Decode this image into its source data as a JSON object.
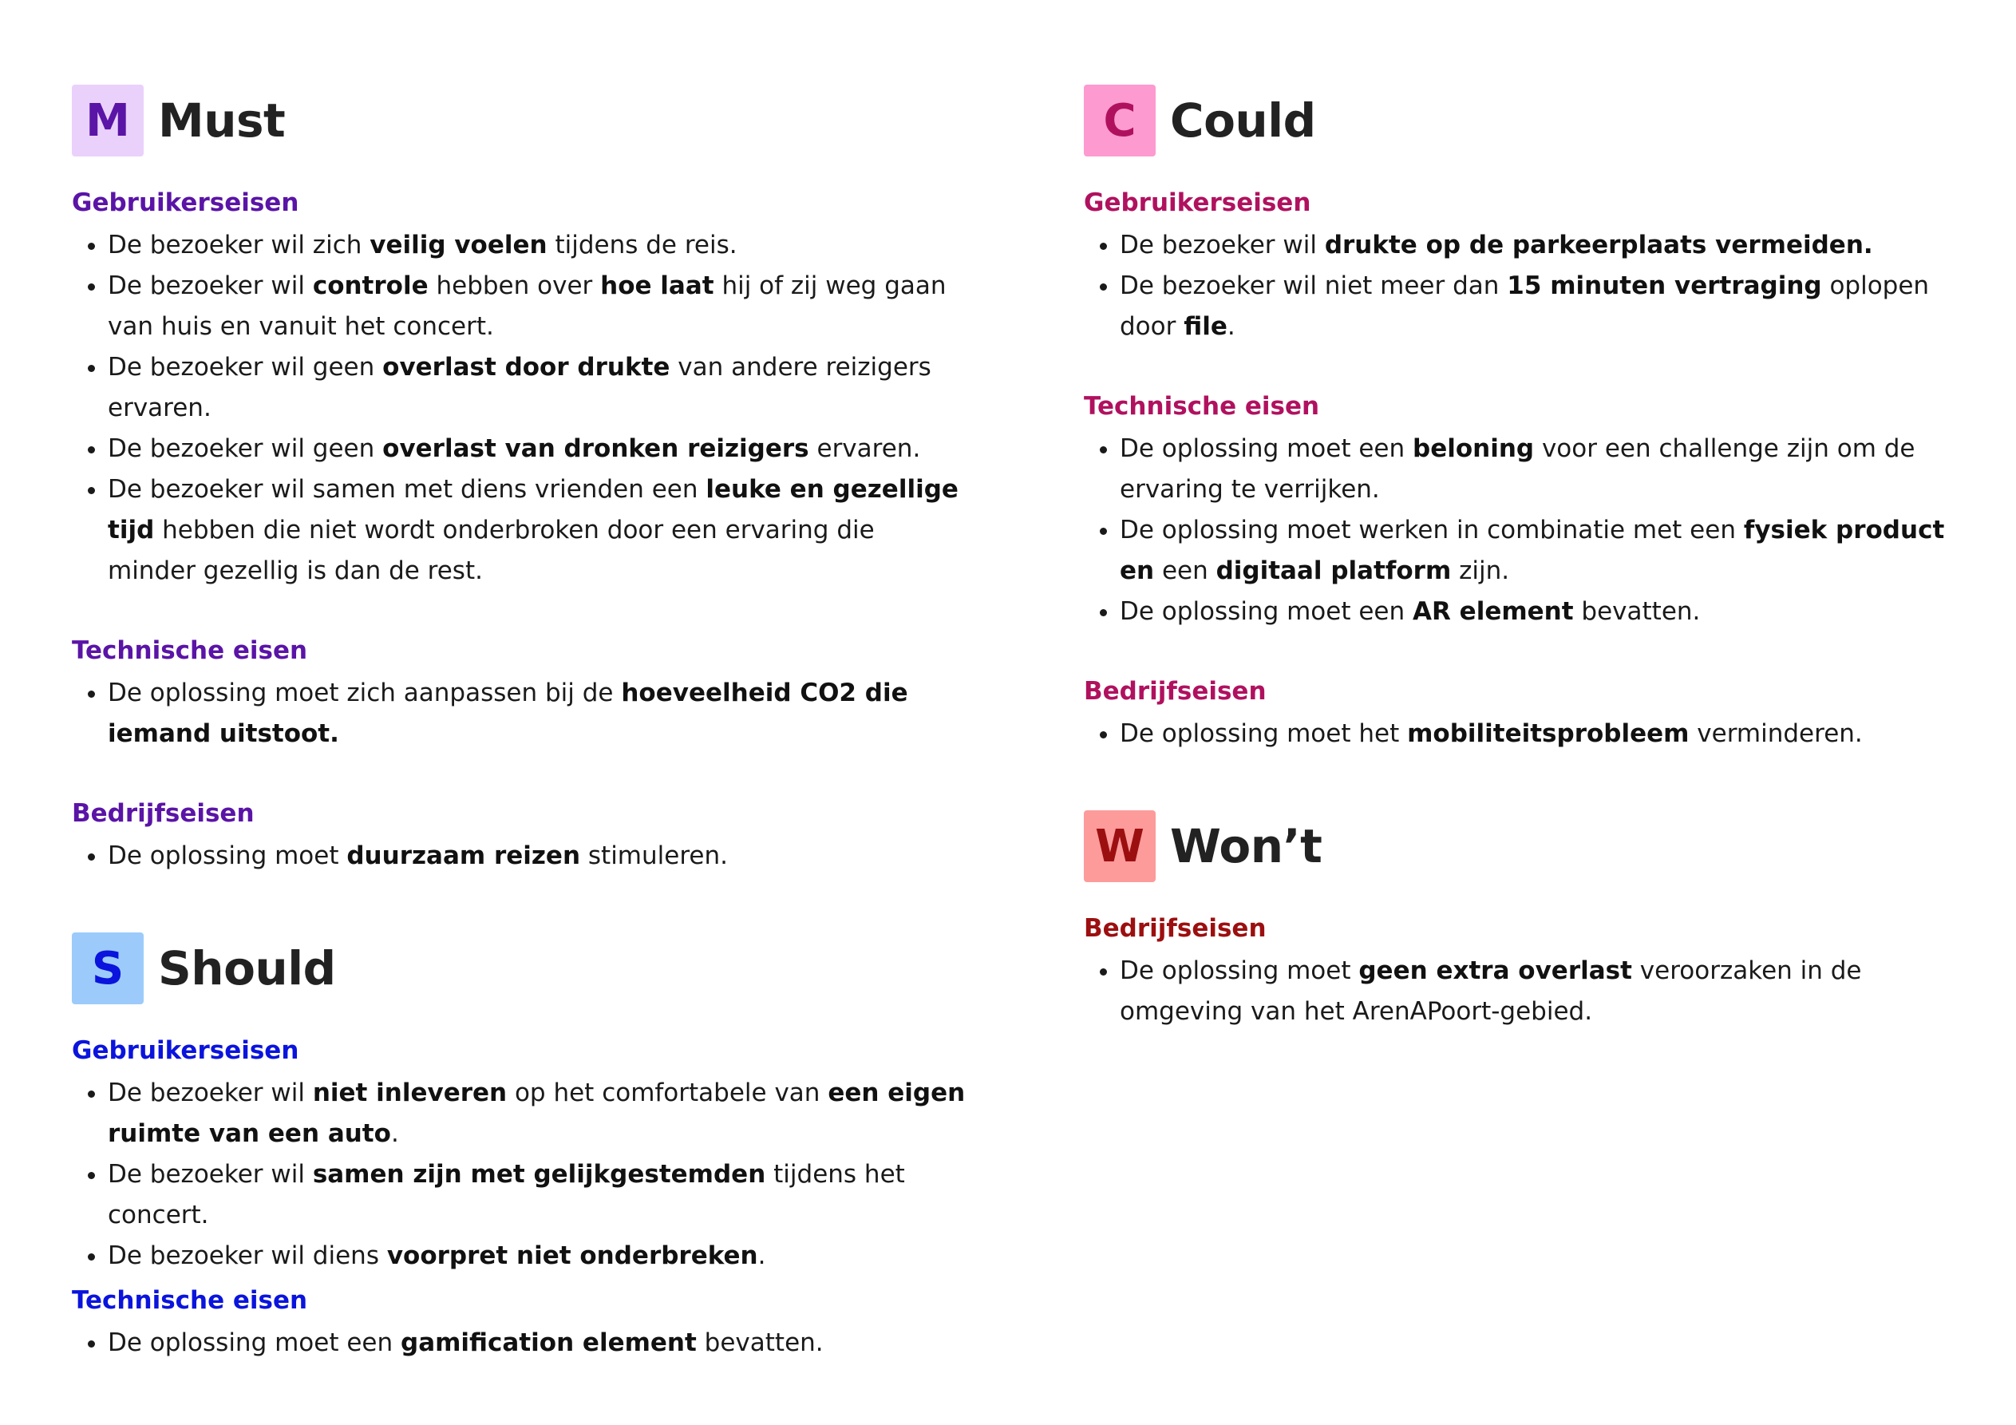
{
  "categories": [
    {
      "key": "must",
      "letter": "M",
      "title": "Must",
      "colors": {
        "bg": "#ead1fb",
        "letter": "#5a14a6",
        "heading": "#5a14a6"
      },
      "groups": [
        {
          "title": "Gebruikerseisen",
          "items": [
            [
              {
                "t": "De bezoeker wil zich "
              },
              {
                "t": "veilig voelen",
                "b": true
              },
              {
                "t": " tijdens de reis."
              }
            ],
            [
              {
                "t": "De bezoeker wil "
              },
              {
                "t": "controle",
                "b": true
              },
              {
                "t": " hebben over "
              },
              {
                "t": "hoe laat",
                "b": true
              },
              {
                "t": " hij of zij weg gaan van huis en vanuit het concert."
              }
            ],
            [
              {
                "t": "De bezoeker wil geen "
              },
              {
                "t": "overlast door drukte",
                "b": true
              },
              {
                "t": " van andere reizigers ervaren."
              }
            ],
            [
              {
                "t": "De bezoeker wil geen "
              },
              {
                "t": "overlast van dronken reizigers",
                "b": true
              },
              {
                "t": " ervaren."
              }
            ],
            [
              {
                "t": "De bezoeker wil samen met diens vrienden een "
              },
              {
                "t": "leuke en gezellige tijd",
                "b": true
              },
              {
                "t": " hebben die niet wordt onderbroken door een ervaring die minder gezellig is dan de rest."
              }
            ]
          ]
        },
        {
          "title": "Technische eisen",
          "items": [
            [
              {
                "t": "De oplossing moet zich aanpassen bij de "
              },
              {
                "t": "hoeveelheid CO2 die iemand uitstoot.",
                "b": true
              }
            ]
          ]
        },
        {
          "title": "Bedrijfseisen",
          "items": [
            [
              {
                "t": "De oplossing moet "
              },
              {
                "t": "duurzaam reizen",
                "b": true
              },
              {
                "t": " stimuleren."
              }
            ]
          ]
        }
      ]
    },
    {
      "key": "should",
      "letter": "S",
      "title": "Should",
      "colors": {
        "bg": "#9ccbfb",
        "letter": "#0a14dc",
        "heading": "#0a14dc"
      },
      "groups": [
        {
          "title": "Gebruikerseisen",
          "items": [
            [
              {
                "t": "De bezoeker wil "
              },
              {
                "t": "niet inleveren",
                "b": true
              },
              {
                "t": " op het comfortabele van "
              },
              {
                "t": "een eigen ruimte van een auto",
                "b": true
              },
              {
                "t": "."
              }
            ],
            [
              {
                "t": "De bezoeker wil "
              },
              {
                "t": "samen zijn met gelijkgestemden",
                "b": true
              },
              {
                "t": " tijdens het concert."
              }
            ],
            [
              {
                "t": "De bezoeker wil diens "
              },
              {
                "t": "voorpret niet onderbreken",
                "b": true
              },
              {
                "t": "."
              }
            ]
          ]
        },
        {
          "title": "Technische eisen",
          "items": [
            [
              {
                "t": "De oplossing moet een "
              },
              {
                "t": "gamification element",
                "b": true
              },
              {
                "t": " bevatten."
              }
            ]
          ]
        }
      ]
    },
    {
      "key": "could",
      "letter": "C",
      "title": "Could",
      "colors": {
        "bg": "#fd9ad0",
        "letter": "#b0115f",
        "heading": "#b0115f"
      },
      "groups": [
        {
          "title": "Gebruikerseisen",
          "items": [
            [
              {
                "t": "De bezoeker wil "
              },
              {
                "t": "drukte op de parkeerplaats vermeiden.",
                "b": true
              }
            ],
            [
              {
                "t": "De bezoeker wil niet meer dan "
              },
              {
                "t": "15 minuten vertraging",
                "b": true
              },
              {
                "t": " oplopen door "
              },
              {
                "t": "file",
                "b": true
              },
              {
                "t": "."
              }
            ]
          ]
        },
        {
          "title": "Technische eisen",
          "items": [
            [
              {
                "t": "De oplossing moet een "
              },
              {
                "t": "beloning",
                "b": true
              },
              {
                "t": " voor een challenge zijn om de ervaring te verrijken."
              }
            ],
            [
              {
                "t": "De oplossing moet werken in combinatie met een "
              },
              {
                "t": "fysiek product en",
                "b": true
              },
              {
                "t": " een "
              },
              {
                "t": "digitaal platform",
                "b": true
              },
              {
                "t": " zijn."
              }
            ],
            [
              {
                "t": "De oplossing moet een "
              },
              {
                "t": "AR element",
                "b": true
              },
              {
                "t": " bevatten."
              }
            ]
          ]
        },
        {
          "title": "Bedrijfseisen",
          "items": [
            [
              {
                "t": "De oplossing moet het "
              },
              {
                "t": "mobiliteitsprobleem",
                "b": true
              },
              {
                "t": " verminderen."
              }
            ]
          ]
        }
      ]
    },
    {
      "key": "wont",
      "letter": "W",
      "title": "Won’t",
      "colors": {
        "bg": "#fd9b9b",
        "letter": "#9c0f10",
        "heading": "#9c0f10"
      },
      "groups": [
        {
          "title": "Bedrijfseisen",
          "items": [
            [
              {
                "t": "De oplossing moet "
              },
              {
                "t": "geen extra overlast",
                "b": true
              },
              {
                "t": " veroorzaken in de omgeving van het ArenAPoort-gebied."
              }
            ]
          ]
        }
      ]
    }
  ]
}
